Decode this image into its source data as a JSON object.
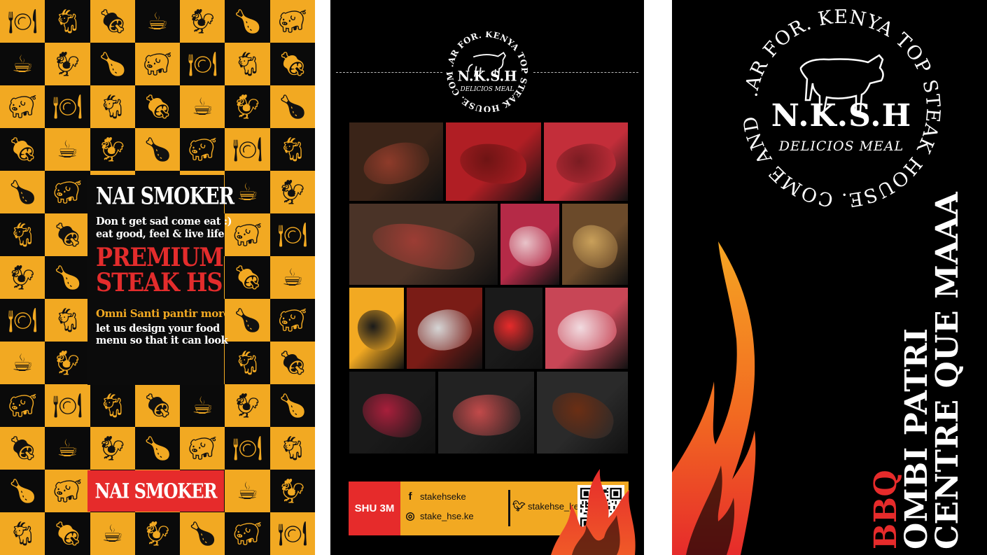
{
  "brand": {
    "name": "N.K.S.H",
    "tagline": "DELICIOS MEAL",
    "ring_text": ".AR FOR. KENYA TOP STEAK HOUSE. COME AND"
  },
  "menu": {
    "title": "NAI SMOKER",
    "line1": "Don t get sad come eat :)",
    "line2": "eat good, feel & live life",
    "premium1": "PREMIUM",
    "premium2": "STEAK HS",
    "gold": "Omni Santi pantir more",
    "line3": "let us design your food",
    "line4": "menu so that it can look",
    "footer": "NAI SMOKER"
  },
  "icons": [
    "plate-icon",
    "goat-icon",
    "ham-icon",
    "gravy-boat-icon",
    "chicken-icon",
    "roast-chicken-icon",
    "pig-icon"
  ],
  "contact": {
    "shu": "SHU 3M",
    "facebook": "stakehseke",
    "instagram": "stake_hse.ke",
    "twitter": "stakehse_ke"
  },
  "cover": {
    "bbq": "BBQ",
    "line1": "OMBI PATRI",
    "line2": "CENTRE QUE MAAA"
  },
  "colors": {
    "gold": "#F2A922",
    "red": "#E62B2B",
    "black": "#000000"
  }
}
